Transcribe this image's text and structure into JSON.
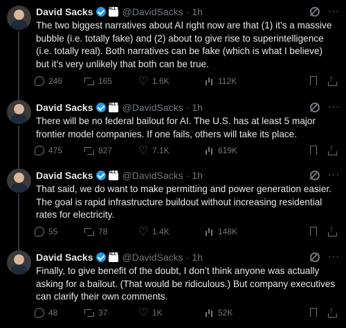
{
  "author": {
    "name": "David Sacks",
    "handle": "@DavidSacks",
    "affiliate_badge_text": "ALL IN"
  },
  "posts": [
    {
      "time": "1h",
      "text": "The two biggest narratives about AI right now are that (1) it’s a massive bubble (i.e. totally fake) and (2) about to give rise to superintelligence (i.e. totally real). Both narratives can be fake (which is what I believe) but it’s very unlikely that both can be true.",
      "replies": "246",
      "reposts": "165",
      "likes": "1.6K",
      "views": "112K"
    },
    {
      "time": "1h",
      "text": "There will be no federal bailout for AI. The U.S. has at least 5 major frontier model companies. If one fails, others will take its place.",
      "replies": "475",
      "reposts": "827",
      "likes": "7.1K",
      "views": "619K"
    },
    {
      "time": "1h",
      "text": "That said, we do want to make permitting and power generation easier. The goal is rapid infrastructure buildout without increasing residential rates for electricity.",
      "replies": "55",
      "reposts": "78",
      "likes": "1.4K",
      "views": "148K"
    },
    {
      "time": "1h",
      "text": "Finally, to give benefit of the doubt, I don’t think anyone was actually asking for a bailout. (That would be ridiculous.) But company executives can clarify their own comments.",
      "replies": "48",
      "reposts": "37",
      "likes": "1K",
      "views": "52K"
    }
  ],
  "icons": {
    "reply": "reply-icon",
    "repost": "repost-icon",
    "like": "like-icon",
    "views": "views-icon",
    "bookmark": "bookmark-icon",
    "share": "share-icon",
    "grok": "grok-icon",
    "more": "more-icon",
    "verified": "verified-badge-icon",
    "affiliate": "affiliate-badge-icon"
  },
  "colors": {
    "background": "#000000",
    "text": "#e7e9ea",
    "muted": "#71767b",
    "verified": "#1d9bf0",
    "thread_line": "#333639"
  }
}
